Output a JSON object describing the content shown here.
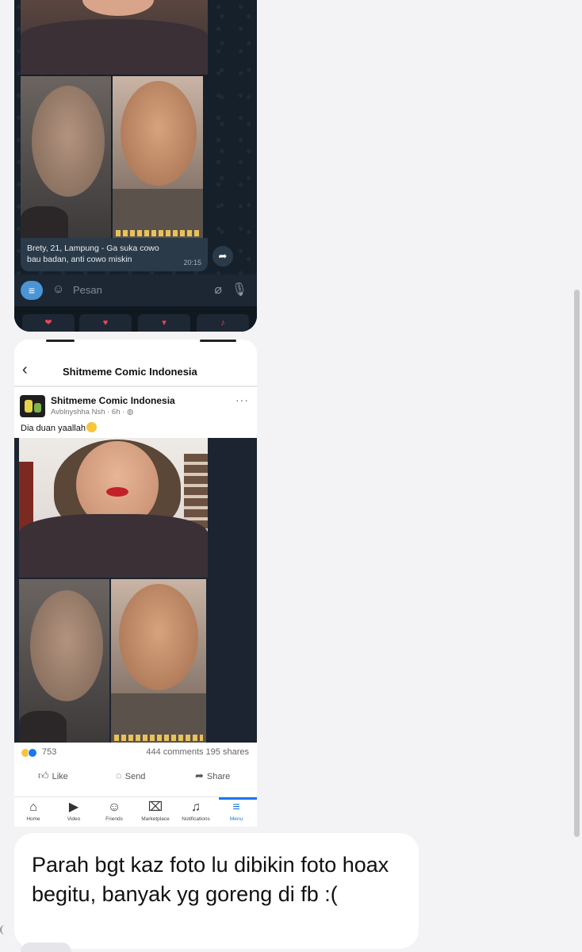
{
  "telegram_screenshot": {
    "caption_line1": "Brety, 21, Lampung - Ga suka cowo",
    "caption_line2": "bau badan, anti cowo miskin",
    "time": "20:15",
    "input_placeholder": "Pesan",
    "icons": [
      "menu-icon",
      "sticker-icon",
      "attach-icon",
      "microphone-icon",
      "forward-icon"
    ]
  },
  "facebook_screenshot": {
    "header_title": "Shitmeme Comic Indonesia",
    "post": {
      "author": "Shitmeme Comic Indonesia",
      "meta": "Avblnyshha Nsh · 6h ·",
      "text": "Dia duan yaallah",
      "more": "···"
    },
    "stats": {
      "reaction_count": "753",
      "comments_shares": "444 comments  195 shares"
    },
    "actions": {
      "like": "Like",
      "send": "Send",
      "share": "Share"
    },
    "nav": [
      {
        "label": "Home",
        "icon": "home-icon"
      },
      {
        "label": "Video",
        "icon": "video-icon"
      },
      {
        "label": "Friends",
        "icon": "friends-icon"
      },
      {
        "label": "Marketplace",
        "icon": "marketplace-icon"
      },
      {
        "label": "Notifications",
        "icon": "bell-icon"
      },
      {
        "label": "Menu",
        "icon": "menu-icon"
      }
    ],
    "accent_color": "#1877f2"
  },
  "message": {
    "text": "Parah bgt kaz foto lu dibikin foto hoax begitu, banyak yg goreng di fb :("
  }
}
